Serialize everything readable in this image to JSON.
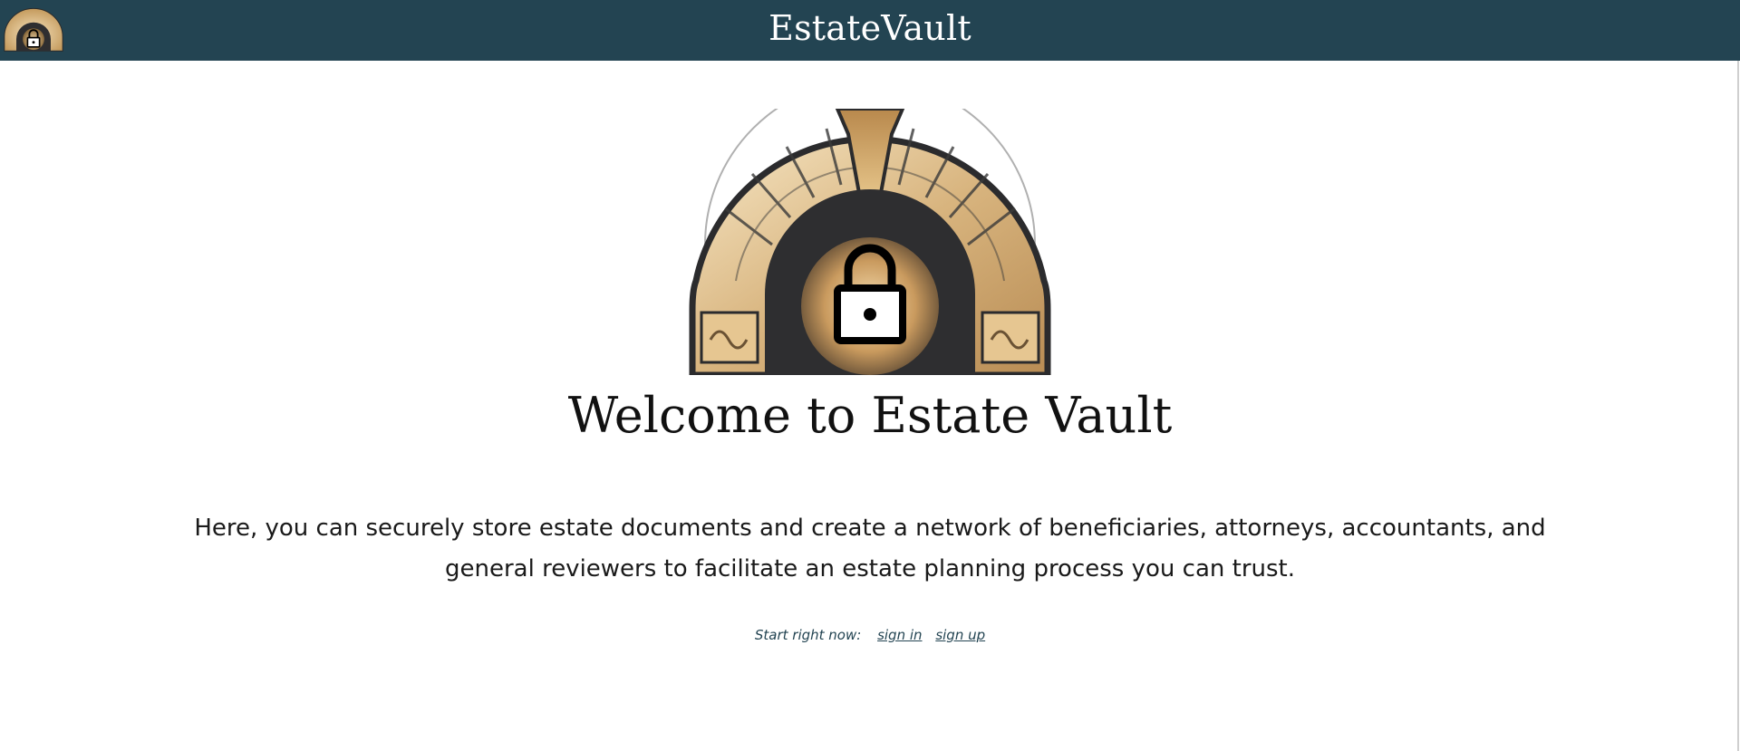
{
  "header": {
    "app_title": "EstateVault",
    "logo_icon": "vault-arch-lock-icon"
  },
  "hero": {
    "logo_icon": "vault-arch-lock-icon",
    "heading": "Welcome to Estate Vault",
    "description": "Here, you can securely store estate documents and create a network of beneficiaries, attorneys, accountants, and general reviewers to facilitate an estate planning process you can trust."
  },
  "cta": {
    "label": "Start right now:",
    "sign_in": "sign in",
    "sign_up": "sign up"
  },
  "colors": {
    "header_bg": "#234452",
    "header_text": "#ffffff",
    "stone": "#d9b47c",
    "vault_dark": "#2e2e30"
  }
}
